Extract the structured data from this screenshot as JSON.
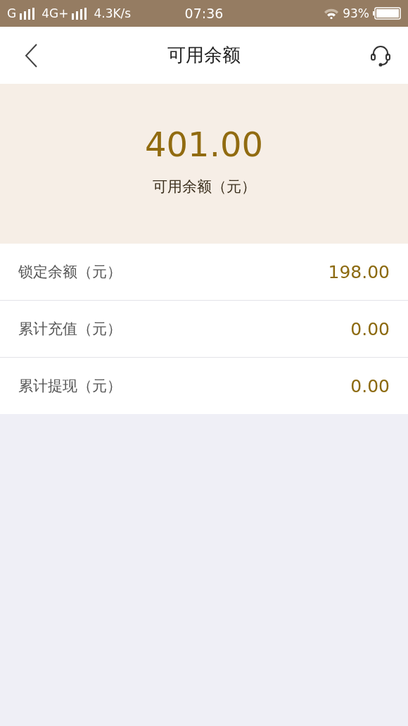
{
  "status_bar": {
    "carrier": "G",
    "network": "4G+",
    "speed": "4.3K/s",
    "time": "07:36",
    "battery": "93%"
  },
  "nav": {
    "title": "可用余额"
  },
  "balance": {
    "amount": "401.00",
    "label": "可用余额（元）"
  },
  "rows": [
    {
      "label": "锁定余额（元）",
      "value": "198.00"
    },
    {
      "label": "累计充值（元）",
      "value": "0.00"
    },
    {
      "label": "累计提现（元）",
      "value": "0.00"
    }
  ]
}
